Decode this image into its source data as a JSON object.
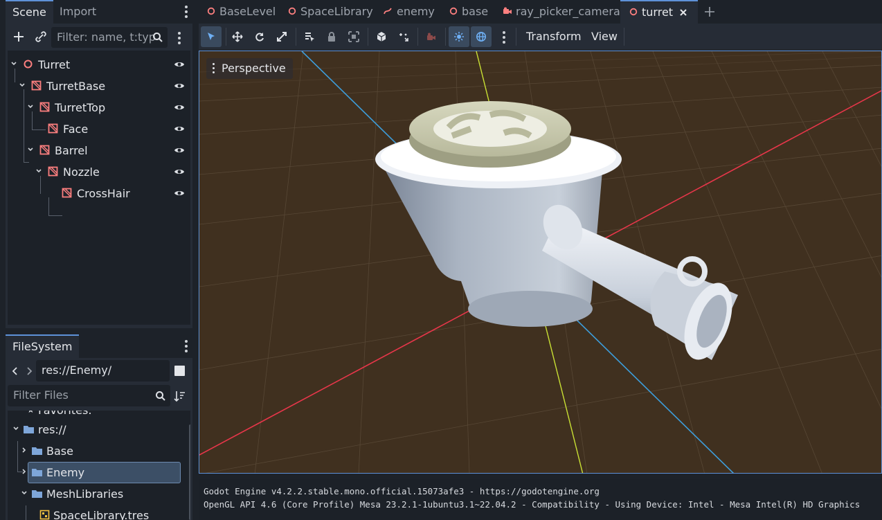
{
  "scene_dock": {
    "tabs": [
      "Scene",
      "Import"
    ],
    "filter_placeholder": "Filter: name, t:typ",
    "nodes": [
      {
        "name": "Turret",
        "type": "root",
        "expanded": true
      },
      {
        "name": "TurretBase",
        "type": "mesh",
        "expanded": true
      },
      {
        "name": "TurretTop",
        "type": "mesh",
        "expanded": true
      },
      {
        "name": "Face",
        "type": "mesh"
      },
      {
        "name": "Barrel",
        "type": "mesh",
        "expanded": true
      },
      {
        "name": "Nozzle",
        "type": "mesh",
        "expanded": true
      },
      {
        "name": "CrossHair",
        "type": "mesh"
      }
    ]
  },
  "filesystem_dock": {
    "tab": "FileSystem",
    "path": "res://Enemy/",
    "filter_placeholder": "Filter Files",
    "items": [
      {
        "label": "Favorites:",
        "kind": "favorites"
      },
      {
        "label": "res://",
        "kind": "folder"
      },
      {
        "label": "Base",
        "kind": "folder"
      },
      {
        "label": "Enemy",
        "kind": "folder",
        "selected": true
      },
      {
        "label": "MeshLibraries",
        "kind": "folder"
      },
      {
        "label": "SpaceLibrary.tres",
        "kind": "file"
      }
    ]
  },
  "scene_tabs": [
    {
      "label": "BaseLevel",
      "icon": "node3d-icon"
    },
    {
      "label": "SpaceLibrary",
      "icon": "node3d-icon"
    },
    {
      "label": "enemy",
      "icon": "path-icon"
    },
    {
      "label": "base",
      "icon": "node3d-icon"
    },
    {
      "label": "ray_picker_camera",
      "icon": "camera-icon"
    },
    {
      "label": "turret",
      "icon": "node3d-icon",
      "active": true
    }
  ],
  "toolbar": {
    "menus": [
      "Transform",
      "View"
    ]
  },
  "viewport": {
    "perspective_label": "Perspective"
  },
  "output": {
    "lines": [
      "Godot Engine v4.2.2.stable.mono.official.15073afe3 - https://godotengine.org",
      "OpenGL API 4.6 (Core Profile) Mesa 23.2.1-1ubuntu3.1~22.04.2 - Compatibility - Using Device: Intel - Mesa Intel(R) HD Graphics"
    ]
  },
  "colors": {
    "accent": "#5e92d9",
    "node_icon": "#fc7f7f",
    "folder_icon": "#7ea6d9",
    "axis_x": "#e8364a",
    "axis_y": "#c9e034",
    "axis_z": "#3d9edc",
    "ground": "#40301f"
  }
}
